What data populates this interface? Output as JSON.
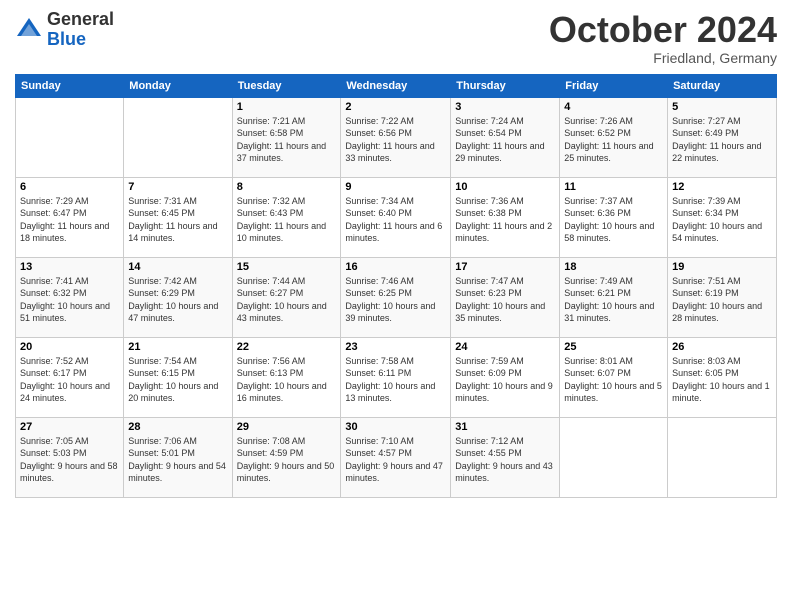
{
  "header": {
    "logo_general": "General",
    "logo_blue": "Blue",
    "month_title": "October 2024",
    "location": "Friedland, Germany"
  },
  "weekdays": [
    "Sunday",
    "Monday",
    "Tuesday",
    "Wednesday",
    "Thursday",
    "Friday",
    "Saturday"
  ],
  "weeks": [
    [
      {
        "day": "",
        "sunrise": "",
        "sunset": "",
        "daylight": ""
      },
      {
        "day": "",
        "sunrise": "",
        "sunset": "",
        "daylight": ""
      },
      {
        "day": "1",
        "sunrise": "Sunrise: 7:21 AM",
        "sunset": "Sunset: 6:58 PM",
        "daylight": "Daylight: 11 hours and 37 minutes."
      },
      {
        "day": "2",
        "sunrise": "Sunrise: 7:22 AM",
        "sunset": "Sunset: 6:56 PM",
        "daylight": "Daylight: 11 hours and 33 minutes."
      },
      {
        "day": "3",
        "sunrise": "Sunrise: 7:24 AM",
        "sunset": "Sunset: 6:54 PM",
        "daylight": "Daylight: 11 hours and 29 minutes."
      },
      {
        "day": "4",
        "sunrise": "Sunrise: 7:26 AM",
        "sunset": "Sunset: 6:52 PM",
        "daylight": "Daylight: 11 hours and 25 minutes."
      },
      {
        "day": "5",
        "sunrise": "Sunrise: 7:27 AM",
        "sunset": "Sunset: 6:49 PM",
        "daylight": "Daylight: 11 hours and 22 minutes."
      }
    ],
    [
      {
        "day": "6",
        "sunrise": "Sunrise: 7:29 AM",
        "sunset": "Sunset: 6:47 PM",
        "daylight": "Daylight: 11 hours and 18 minutes."
      },
      {
        "day": "7",
        "sunrise": "Sunrise: 7:31 AM",
        "sunset": "Sunset: 6:45 PM",
        "daylight": "Daylight: 11 hours and 14 minutes."
      },
      {
        "day": "8",
        "sunrise": "Sunrise: 7:32 AM",
        "sunset": "Sunset: 6:43 PM",
        "daylight": "Daylight: 11 hours and 10 minutes."
      },
      {
        "day": "9",
        "sunrise": "Sunrise: 7:34 AM",
        "sunset": "Sunset: 6:40 PM",
        "daylight": "Daylight: 11 hours and 6 minutes."
      },
      {
        "day": "10",
        "sunrise": "Sunrise: 7:36 AM",
        "sunset": "Sunset: 6:38 PM",
        "daylight": "Daylight: 11 hours and 2 minutes."
      },
      {
        "day": "11",
        "sunrise": "Sunrise: 7:37 AM",
        "sunset": "Sunset: 6:36 PM",
        "daylight": "Daylight: 10 hours and 58 minutes."
      },
      {
        "day": "12",
        "sunrise": "Sunrise: 7:39 AM",
        "sunset": "Sunset: 6:34 PM",
        "daylight": "Daylight: 10 hours and 54 minutes."
      }
    ],
    [
      {
        "day": "13",
        "sunrise": "Sunrise: 7:41 AM",
        "sunset": "Sunset: 6:32 PM",
        "daylight": "Daylight: 10 hours and 51 minutes."
      },
      {
        "day": "14",
        "sunrise": "Sunrise: 7:42 AM",
        "sunset": "Sunset: 6:29 PM",
        "daylight": "Daylight: 10 hours and 47 minutes."
      },
      {
        "day": "15",
        "sunrise": "Sunrise: 7:44 AM",
        "sunset": "Sunset: 6:27 PM",
        "daylight": "Daylight: 10 hours and 43 minutes."
      },
      {
        "day": "16",
        "sunrise": "Sunrise: 7:46 AM",
        "sunset": "Sunset: 6:25 PM",
        "daylight": "Daylight: 10 hours and 39 minutes."
      },
      {
        "day": "17",
        "sunrise": "Sunrise: 7:47 AM",
        "sunset": "Sunset: 6:23 PM",
        "daylight": "Daylight: 10 hours and 35 minutes."
      },
      {
        "day": "18",
        "sunrise": "Sunrise: 7:49 AM",
        "sunset": "Sunset: 6:21 PM",
        "daylight": "Daylight: 10 hours and 31 minutes."
      },
      {
        "day": "19",
        "sunrise": "Sunrise: 7:51 AM",
        "sunset": "Sunset: 6:19 PM",
        "daylight": "Daylight: 10 hours and 28 minutes."
      }
    ],
    [
      {
        "day": "20",
        "sunrise": "Sunrise: 7:52 AM",
        "sunset": "Sunset: 6:17 PM",
        "daylight": "Daylight: 10 hours and 24 minutes."
      },
      {
        "day": "21",
        "sunrise": "Sunrise: 7:54 AM",
        "sunset": "Sunset: 6:15 PM",
        "daylight": "Daylight: 10 hours and 20 minutes."
      },
      {
        "day": "22",
        "sunrise": "Sunrise: 7:56 AM",
        "sunset": "Sunset: 6:13 PM",
        "daylight": "Daylight: 10 hours and 16 minutes."
      },
      {
        "day": "23",
        "sunrise": "Sunrise: 7:58 AM",
        "sunset": "Sunset: 6:11 PM",
        "daylight": "Daylight: 10 hours and 13 minutes."
      },
      {
        "day": "24",
        "sunrise": "Sunrise: 7:59 AM",
        "sunset": "Sunset: 6:09 PM",
        "daylight": "Daylight: 10 hours and 9 minutes."
      },
      {
        "day": "25",
        "sunrise": "Sunrise: 8:01 AM",
        "sunset": "Sunset: 6:07 PM",
        "daylight": "Daylight: 10 hours and 5 minutes."
      },
      {
        "day": "26",
        "sunrise": "Sunrise: 8:03 AM",
        "sunset": "Sunset: 6:05 PM",
        "daylight": "Daylight: 10 hours and 1 minute."
      }
    ],
    [
      {
        "day": "27",
        "sunrise": "Sunrise: 7:05 AM",
        "sunset": "Sunset: 5:03 PM",
        "daylight": "Daylight: 9 hours and 58 minutes."
      },
      {
        "day": "28",
        "sunrise": "Sunrise: 7:06 AM",
        "sunset": "Sunset: 5:01 PM",
        "daylight": "Daylight: 9 hours and 54 minutes."
      },
      {
        "day": "29",
        "sunrise": "Sunrise: 7:08 AM",
        "sunset": "Sunset: 4:59 PM",
        "daylight": "Daylight: 9 hours and 50 minutes."
      },
      {
        "day": "30",
        "sunrise": "Sunrise: 7:10 AM",
        "sunset": "Sunset: 4:57 PM",
        "daylight": "Daylight: 9 hours and 47 minutes."
      },
      {
        "day": "31",
        "sunrise": "Sunrise: 7:12 AM",
        "sunset": "Sunset: 4:55 PM",
        "daylight": "Daylight: 9 hours and 43 minutes."
      },
      {
        "day": "",
        "sunrise": "",
        "sunset": "",
        "daylight": ""
      },
      {
        "day": "",
        "sunrise": "",
        "sunset": "",
        "daylight": ""
      }
    ]
  ]
}
